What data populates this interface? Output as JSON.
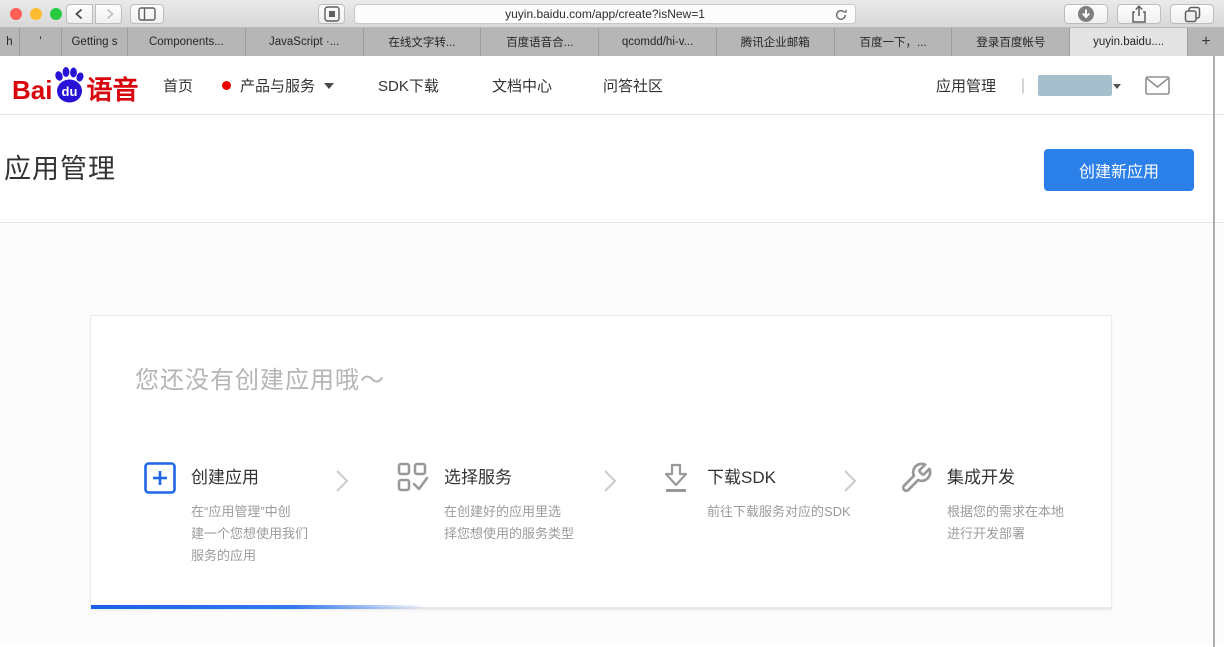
{
  "browser": {
    "toolbar": {
      "url": "yuyin.baidu.com/app/create?isNew=1"
    },
    "tabs": [
      {
        "label": "h"
      },
      {
        "label": "'"
      },
      {
        "label": "Getting s"
      },
      {
        "label": "Components..."
      },
      {
        "label": "JavaScript ·..."
      },
      {
        "label": "在线文字转..."
      },
      {
        "label": "百度语音合..."
      },
      {
        "label": "qcomdd/hi-v..."
      },
      {
        "label": "腾讯企业邮箱"
      },
      {
        "label": "百度一下，..."
      },
      {
        "label": "登录百度帐号"
      },
      {
        "label": "yuyin.baidu...."
      }
    ],
    "new_tab": "+"
  },
  "header": {
    "logo": {
      "bai": "Bai",
      "du": "du",
      "product": "语音"
    },
    "nav": {
      "home": "首页",
      "products": "产品与服务",
      "sdk": "SDK下载",
      "docs": "文档中心",
      "community": "问答社区"
    },
    "right": {
      "app_manage": "应用管理",
      "divider": "|"
    }
  },
  "page": {
    "title": "应用管理",
    "create_button": "创建新应用"
  },
  "card": {
    "empty_message": "您还没有创建应用哦～",
    "steps": [
      {
        "title": "创建应用",
        "desc": [
          "在“应用管理”中创",
          "建一个您想使用我们",
          "服务的应用"
        ]
      },
      {
        "title": "选择服务",
        "desc": [
          "在创建好的应用里选",
          "择您想使用的服务类型"
        ]
      },
      {
        "title": "下载SDK",
        "desc": [
          "前往下载服务对应的SDK"
        ]
      },
      {
        "title": "集成开发",
        "desc": [
          "根据您的需求在本地",
          "进行开发部署"
        ]
      }
    ]
  },
  "colors": {
    "accent_blue": "#2b7fe8",
    "progress_blue": "#1b5fe8",
    "brand_red": "#d8050c",
    "paw_blue": "#2712d6",
    "dot_red": "#ec0000"
  }
}
